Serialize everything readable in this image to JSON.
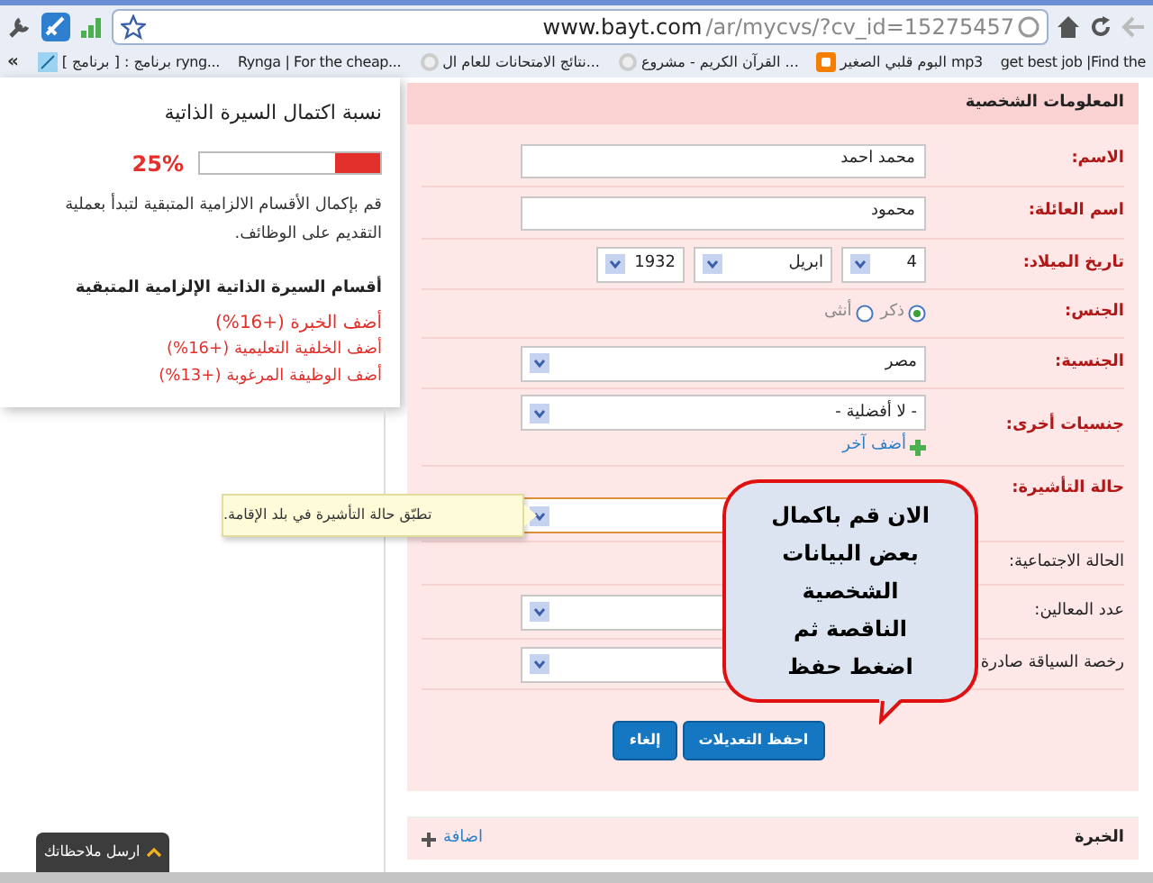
{
  "browser": {
    "url_host": "www.bayt.com",
    "url_path": "/ar/mycvs/?cv_id=15275457",
    "more": "«",
    "bookmarks": [
      {
        "kind": "plain",
        "label": "get best job |Find the"
      },
      {
        "kind": "blogger",
        "label": "البوم قلبي الصغير mp3"
      },
      {
        "kind": "globe",
        "label": "القرآن الكريم - مشروع ..."
      },
      {
        "kind": "globe",
        "label": "نتائج الامتحانات للعام ال..."
      },
      {
        "kind": "plain",
        "label": "Rynga | For the cheap..."
      },
      {
        "kind": "app",
        "label": "[ برنامج ] : برنامج ryng..."
      }
    ]
  },
  "sidebar": {
    "title": "نسبة اكتمال السيرة الذاتية",
    "percent": "25%",
    "level": 0.25,
    "description": "قم بإكمال الأقسام الالزامية المتبقية لتبدأ بعملية التقديم على الوظائف.",
    "sections_title": "أقسام السيرة الذاتية الإلزامية المتبقية",
    "links": [
      {
        "label": "أضف الخبرة (+16%)",
        "primary": true
      },
      {
        "label": "أضف الخلفية التعليمية (+16%)",
        "primary": false
      },
      {
        "label": "أضف الوظيفة المرغوبة (+13%)",
        "primary": false
      }
    ]
  },
  "form": {
    "title": "المعلومات الشخصية",
    "fields": [
      {
        "kind": "text",
        "label": "الاسم:",
        "value": "محمد احمد"
      },
      {
        "kind": "text",
        "label": "اسم العائلة:",
        "value": "محمود"
      },
      {
        "kind": "date",
        "label": "تاريخ الميلاد:",
        "day": "4",
        "month": "ابريل",
        "year": "1932"
      },
      {
        "kind": "radio",
        "label": "الجنس:",
        "options": [
          {
            "label": "ذكر",
            "selected": true
          },
          {
            "label": "أنثى",
            "selected": false
          }
        ]
      },
      {
        "kind": "select",
        "label": "الجنسية:",
        "value": "مصر",
        "focused": false
      },
      {
        "kind": "select",
        "label": "جنسيات أخرى:",
        "value": "- لا أفضلية -",
        "focused": false,
        "add_link": "أضف آخر"
      },
      {
        "kind": "select",
        "label": "حالة التأشيرة:",
        "focused": true
      },
      {
        "kind": "none",
        "label": "الحالة الاجتماعية:"
      },
      {
        "kind": "select",
        "label": "عدد المعالين:",
        "focused": false
      },
      {
        "kind": "select",
        "label": "رخصة السياقة صادرة",
        "focused": false
      }
    ],
    "buttons": [
      {
        "label": "احفظ التعديلات"
      },
      {
        "label": "إلغاء"
      }
    ]
  },
  "tooltip": "تطبّق حالة التأشيرة في بلد الإقامة.",
  "callout": "الان قم باكمال بعض البيانات الشخصية الناقصة ثم اضغط حفظ",
  "experience": {
    "title": "الخبرة",
    "add": "اضافة"
  },
  "feedback": "ارسل ملاحظاتك"
}
